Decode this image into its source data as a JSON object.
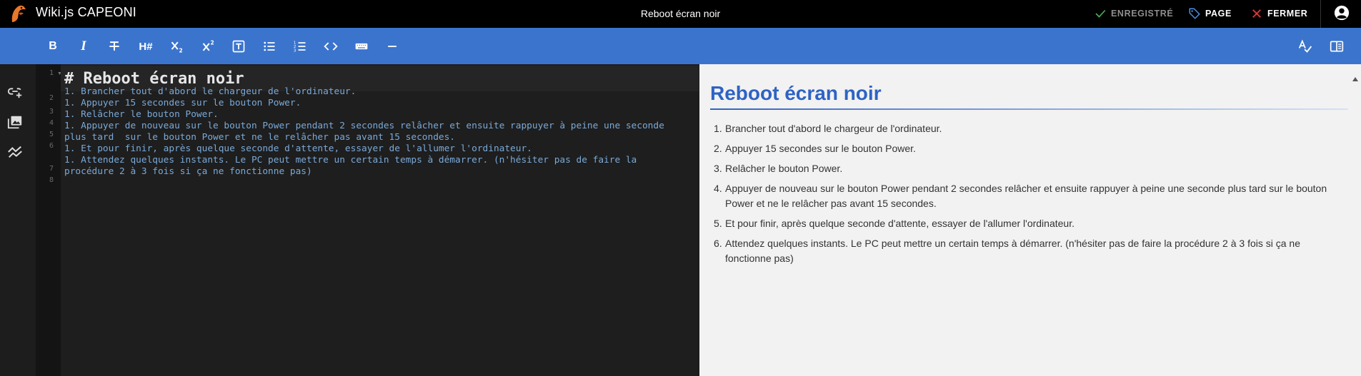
{
  "app": {
    "title": "Wiki.js CAPEONI",
    "page_title": "Reboot écran noir"
  },
  "header_actions": {
    "saved_label": "ENREGISTRÉ",
    "page_label": "PAGE",
    "close_label": "FERMER"
  },
  "toolbar": {
    "items": [
      {
        "name": "bold-button",
        "icon": "bold-icon"
      },
      {
        "name": "italic-button",
        "icon": "italic-icon"
      },
      {
        "name": "strikethrough-button",
        "icon": "strikethrough-icon"
      },
      {
        "name": "heading-button",
        "icon": "heading-icon"
      },
      {
        "name": "subscript-button",
        "icon": "subscript-icon"
      },
      {
        "name": "superscript-button",
        "icon": "superscript-icon"
      },
      {
        "name": "blockquote-button",
        "icon": "text-box-icon"
      },
      {
        "name": "unordered-list-button",
        "icon": "bullet-list-icon"
      },
      {
        "name": "ordered-list-button",
        "icon": "numbered-list-icon"
      },
      {
        "name": "inline-code-button",
        "icon": "code-icon"
      },
      {
        "name": "keyboard-key-button",
        "icon": "keyboard-icon"
      },
      {
        "name": "horizontal-rule-button",
        "icon": "minus-icon"
      }
    ],
    "right_items": [
      {
        "name": "spellcheck-button",
        "icon": "spellcheck-icon"
      },
      {
        "name": "toggle-preview-button",
        "icon": "split-view-icon"
      }
    ]
  },
  "sidebar": {
    "items": [
      {
        "name": "insert-link-button",
        "icon": "link-plus-icon"
      },
      {
        "name": "insert-assets-button",
        "icon": "image-multiple-icon"
      },
      {
        "name": "insert-diagram-button",
        "icon": "chart-icon"
      }
    ]
  },
  "editor": {
    "line_numbers": [
      "1",
      "2",
      "3",
      "4",
      "5",
      "6",
      "",
      "7",
      "8",
      ""
    ],
    "heading": "# Reboot écran noir",
    "lines": [
      "1. Brancher tout d'abord le chargeur de l'ordinateur.",
      "1. Appuyer 15 secondes sur le bouton Power.",
      "1. Relâcher le bouton Power.",
      "1. Appuyer de nouveau sur le bouton Power pendant 2 secondes relâcher et ensuite rappuyer à peine une seconde",
      "plus tard  sur le bouton Power et ne le relâcher pas avant 15 secondes.",
      "1. Et pour finir, après quelque seconde d'attente, essayer de l'allumer l'ordinateur.",
      "1. Attendez quelques instants. Le PC peut mettre un certain temps à démarrer. (n'hésiter pas de faire la",
      "procédure 2 à 3 fois si ça ne fonctionne pas)"
    ]
  },
  "preview": {
    "title": "Reboot écran noir",
    "items": [
      {
        "num": "1.",
        "text": "Brancher tout d'abord le chargeur de l'ordinateur."
      },
      {
        "num": "2.",
        "text": "Appuyer 15 secondes sur le bouton Power."
      },
      {
        "num": "3.",
        "text": "Relâcher le bouton Power."
      },
      {
        "num": "4.",
        "text": "Appuyer de nouveau sur le bouton Power pendant 2 secondes relâcher et ensuite rappuyer à peine une seconde plus tard sur le bouton Power et ne le relâcher pas avant 15 secondes."
      },
      {
        "num": "5.",
        "text": "Et pour finir, après quelque seconde d'attente, essayer de l'allumer l'ordinateur."
      },
      {
        "num": "6.",
        "text": "Attendez quelques instants. Le PC peut mettre un certain temps à démarrer. (n'hésiter pas de faire la procédure 2 à 3 fois si ça ne fonctionne pas)"
      }
    ]
  },
  "colors": {
    "toolbar_bg": "#3b74cc",
    "topbar_bg": "#000000",
    "preview_heading": "#2e63c4",
    "editor_text": "#7aa9d8",
    "saved_check": "#4caf50",
    "page_tag": "#4a8de8",
    "close_x": "#e53935"
  }
}
